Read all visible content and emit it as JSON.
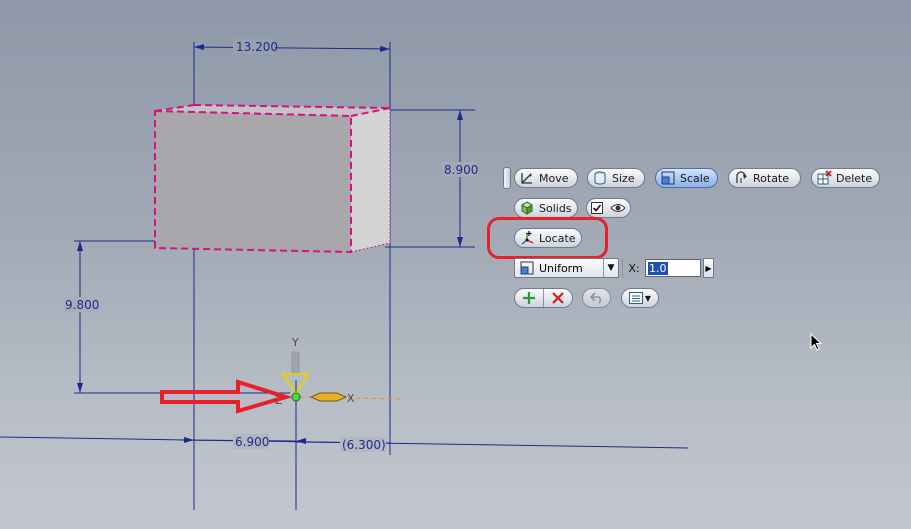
{
  "canvas": {
    "background_color": "#a2aab6"
  },
  "dimensions": {
    "width": "13.200",
    "height": "8.900",
    "offset_y": "9.800",
    "offset_x": "6.900",
    "offset_x_driven": "(6.300)"
  },
  "triad": {
    "x_label": "X",
    "y_label": "Y",
    "z_label": "Z"
  },
  "minitoolbar": {
    "move_label": "Move",
    "size_label": "Size",
    "scale_label": "Scale",
    "rotate_label": "Rotate",
    "delete_label": "Delete",
    "solids_label": "Solids",
    "locate_label": "Locate",
    "scale_mode": "Uniform",
    "scale_axis_label": "X:",
    "scale_value": "1.0",
    "active_tool": "Scale"
  },
  "annotations": {
    "highlight_color": "#e8202a",
    "arrow_color": "#e8202a"
  }
}
